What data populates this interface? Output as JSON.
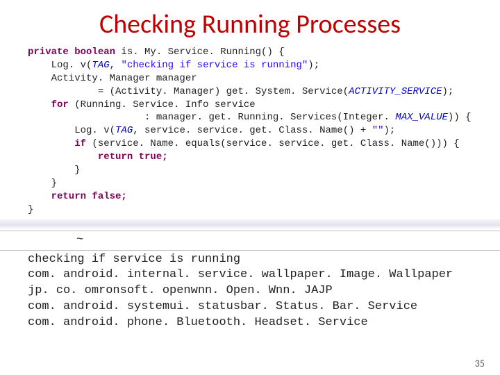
{
  "title": "Checking Running Processes",
  "code": {
    "l1a": "private boolean ",
    "l1b": "is. My. Service. Running() {",
    "l2a": "    Log. v(",
    "l2b": "TAG",
    "l2c": ", ",
    "l2d": "\"checking if service is running\"",
    "l2e": ");",
    "l3": "    Activity. Manager manager",
    "l4a": "            = (Activity. Manager) get. System. Service(",
    "l4b": "ACTIVITY_SERVICE",
    "l4c": ");",
    "l5a": "    for ",
    "l5b": "(Running. Service. Info service",
    "l6a": "                    : manager. get. Running. Services(Integer. ",
    "l6b": "MAX_VALUE",
    "l6c": ")) {",
    "l7a": "        Log. v(",
    "l7b": "TAG",
    "l7c": ", service. service. get. Class. Name() + ",
    "l7d": "\"\"",
    "l7e": ");",
    "l8a": "        if ",
    "l8b": "(service. Name. equals(service. service. get. Class. Name())) {",
    "l9": "            return true;",
    "l10": "        }",
    "l11": "    }",
    "l12": "    return false;",
    "l13": "}"
  },
  "tilde": "~",
  "output": {
    "l1": "checking if service is running",
    "l2": "com. android. internal. service. wallpaper. Image. Wallpaper",
    "l3": "jp. co. omronsoft. openwnn. Open. Wnn. JAJP",
    "l4": "com. android. systemui. statusbar. Status. Bar. Service",
    "l5": "com. android. phone. Bluetooth. Headset. Service"
  },
  "page_number": "35"
}
